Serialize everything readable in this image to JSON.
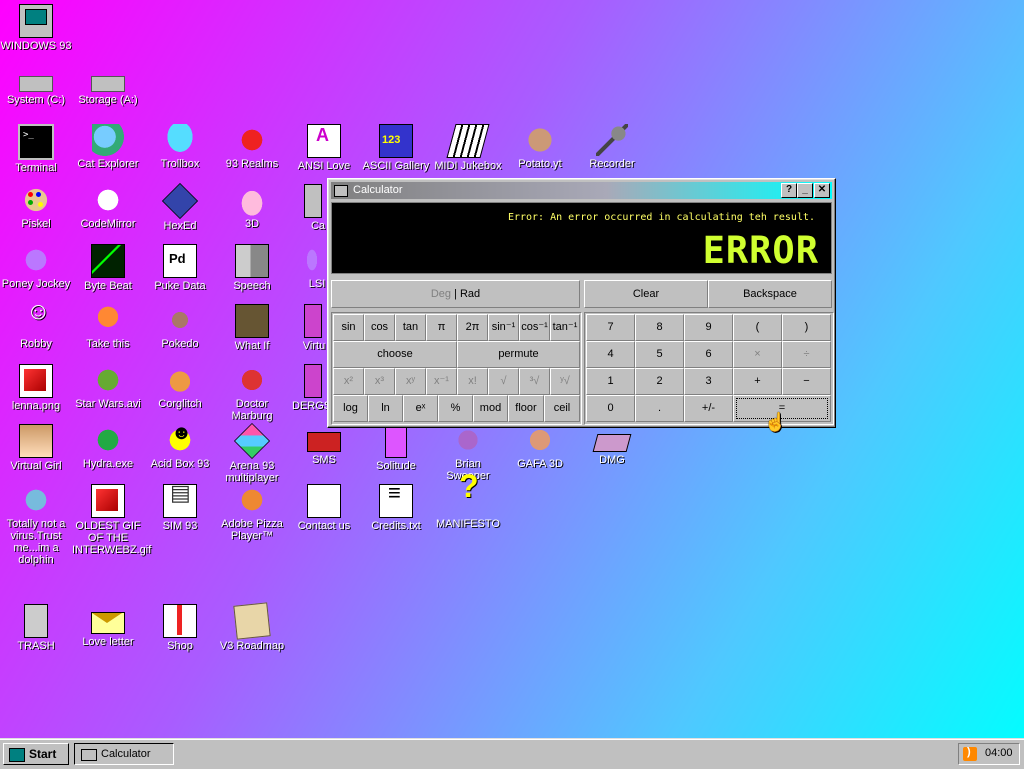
{
  "desktop_icons": [
    {
      "label": "WINDOWS 93",
      "icon": "computer-icon"
    },
    {
      "label": "System (C:)",
      "icon": "hard-drive-icon"
    },
    {
      "label": "Storage (A:)",
      "icon": "floppy-drive-icon"
    },
    {
      "label": "Terminal",
      "icon": "terminal-icon"
    },
    {
      "label": "Cat Explorer",
      "icon": "cat-globe-icon"
    },
    {
      "label": "Trollbox",
      "icon": "chat-bubble-icon"
    },
    {
      "label": "93 Realms",
      "icon": "realms-icon"
    },
    {
      "label": "ANSI Love",
      "icon": "ansi-letter-icon"
    },
    {
      "label": "ASCII Gallery",
      "icon": "ascii-numbers-icon"
    },
    {
      "label": "MIDI Jukebox",
      "icon": "piano-icon"
    },
    {
      "label": "Potato.yt",
      "icon": "potato-icon"
    },
    {
      "label": "Recorder",
      "icon": "microphone-icon"
    },
    {
      "label": "Piskel",
      "icon": "palette-icon"
    },
    {
      "label": "CodeMirror",
      "icon": "codemirror-icon"
    },
    {
      "label": "HexEd",
      "icon": "cube-icon"
    },
    {
      "label": "3D",
      "icon": "teapot-icon"
    },
    {
      "label": "Ca",
      "icon": "calculator-icon"
    },
    {
      "label": "Poney Jockey",
      "icon": "pony-icon"
    },
    {
      "label": "Byte Beat",
      "icon": "bytebeat-icon"
    },
    {
      "label": "Puke Data",
      "icon": "pd-icon"
    },
    {
      "label": "Speech",
      "icon": "speech-face-icon"
    },
    {
      "label": "LSI",
      "icon": "lsd-icon"
    },
    {
      "label": "Robby",
      "icon": "stickman-icon"
    },
    {
      "label": "Take this",
      "icon": "pixel-character-icon"
    },
    {
      "label": "Pokedo",
      "icon": "pokedoge-icon"
    },
    {
      "label": "What If",
      "icon": "whatif-icon"
    },
    {
      "label": "Virtu",
      "icon": "virtual-icon"
    },
    {
      "label": "lenna.png",
      "icon": "image-file-icon"
    },
    {
      "label": "Star Wars.avi",
      "icon": "yoda-icon"
    },
    {
      "label": "Corglitch",
      "icon": "corgi-icon"
    },
    {
      "label": "Doctor Marburg",
      "icon": "doctor-icon"
    },
    {
      "label": "DERGS",
      "icon": "dergs-icon"
    },
    {
      "label": "Virtual Girl",
      "icon": "virtual-girl-icon"
    },
    {
      "label": "Hydra.exe",
      "icon": "hydra-icon"
    },
    {
      "label": "Acid Box 93",
      "icon": "smiley-icon"
    },
    {
      "label": "Arena 93 multiplayer",
      "icon": "arena-cube-icon"
    },
    {
      "label": "SMS",
      "icon": "sms-icon"
    },
    {
      "label": "Solitude",
      "icon": "solitude-icon"
    },
    {
      "label": "Brian Sweeper",
      "icon": "mine-icon"
    },
    {
      "label": "GAFA 3D",
      "icon": "gafa-face-icon"
    },
    {
      "label": "DMG",
      "icon": "dmg-icon"
    },
    {
      "label": "Totally not a virus.Trust me...im a dolphin",
      "icon": "dolphin-icon"
    },
    {
      "label": "OLDEST GIF OF THE INTERWEBZ.gif",
      "icon": "gif-file-icon"
    },
    {
      "label": "SIM 93",
      "icon": "book-icon"
    },
    {
      "label": "Adobe Pizza Player™",
      "icon": "pizza-icon"
    },
    {
      "label": "Contact us",
      "icon": "contact-icon"
    },
    {
      "label": "Credits.txt",
      "icon": "text-file-icon"
    },
    {
      "label": "MANIFESTO",
      "icon": "question-mark-icon"
    },
    {
      "label": "TRASH",
      "icon": "trash-icon"
    },
    {
      "label": "Love letter",
      "icon": "envelope-icon"
    },
    {
      "label": "Shop",
      "icon": "gift-icon"
    },
    {
      "label": "V3 Roadmap",
      "icon": "map-icon"
    }
  ],
  "calculator": {
    "title": "Calculator",
    "title_buttons": {
      "help": "?",
      "minimize": "_",
      "close": "✕"
    },
    "display_message": "Error: An error occurred in calculating teh result.",
    "display_value": "ERROR",
    "mode_deg": "Deg",
    "mode_sep": " | ",
    "mode_rad": "Rad",
    "clear": "Clear",
    "backspace": "Backspace",
    "sci_rows": [
      [
        "sin",
        "cos",
        "tan",
        "π",
        "2π",
        "sin⁻¹",
        "cos⁻¹",
        "tan⁻¹"
      ],
      [
        "choose",
        "permute"
      ],
      [
        "x²",
        "x³",
        "xʸ",
        "x⁻¹",
        "x!",
        "√",
        "³√",
        "ʸ√"
      ],
      [
        "log",
        "ln",
        "eˣ",
        "%",
        "mod",
        "floor",
        "ceil"
      ]
    ],
    "num_rows": [
      [
        "7",
        "8",
        "9",
        "(",
        ")"
      ],
      [
        "4",
        "5",
        "6",
        "×",
        "÷"
      ],
      [
        "1",
        "2",
        "3",
        "+",
        "−"
      ],
      [
        "0",
        ".",
        "+/-",
        "="
      ]
    ]
  },
  "taskbar": {
    "start": "Start",
    "items": [
      "Calculator"
    ],
    "clock": "04:00"
  },
  "colors": {
    "display_text": "#d0ff30",
    "display_message": "#ffff66",
    "window_face": "#c0c0c0"
  }
}
